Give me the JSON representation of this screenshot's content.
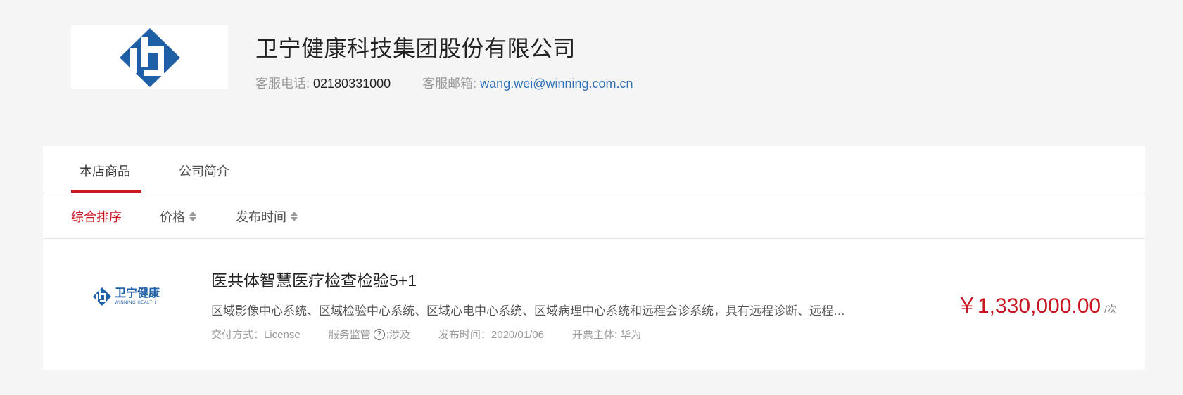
{
  "company": {
    "name": "卫宁健康科技集团股份有限公司",
    "phone_label": "客服电话: ",
    "phone": "02180331000",
    "email_label": "客服邮箱: ",
    "email": "wang.wei@winning.com.cn",
    "brand_color": "#1f5fa6"
  },
  "tabs": [
    {
      "label": "本店商品",
      "active": true
    },
    {
      "label": "公司简介",
      "active": false
    }
  ],
  "sort": [
    {
      "label": "综合排序",
      "active": true
    },
    {
      "label": "价格",
      "active": false
    },
    {
      "label": "发布时间",
      "active": false
    }
  ],
  "product": {
    "logo_cn": "卫宁健康",
    "logo_en": "WINNING HEALTH",
    "title": "医共体智慧医疗检查检验5+1",
    "description": "区域影像中心系统、区域检验中心系统、区域心电中心系统、区域病理中心系统和远程会诊系统，具有远程诊断、远程会诊、双向转诊、质控管理等功能",
    "delivery": "交付方式：License",
    "supervision_label": "服务监管",
    "supervision_value": ":涉及",
    "publish_time": "发布时间：2020/01/06",
    "invoice": "开票主体:   华为",
    "price": "￥1,330,000.00",
    "unit": "/次"
  },
  "colors": {
    "accent": "#c81623",
    "background": "#f5f5f5",
    "link": "#2d6fb6"
  }
}
